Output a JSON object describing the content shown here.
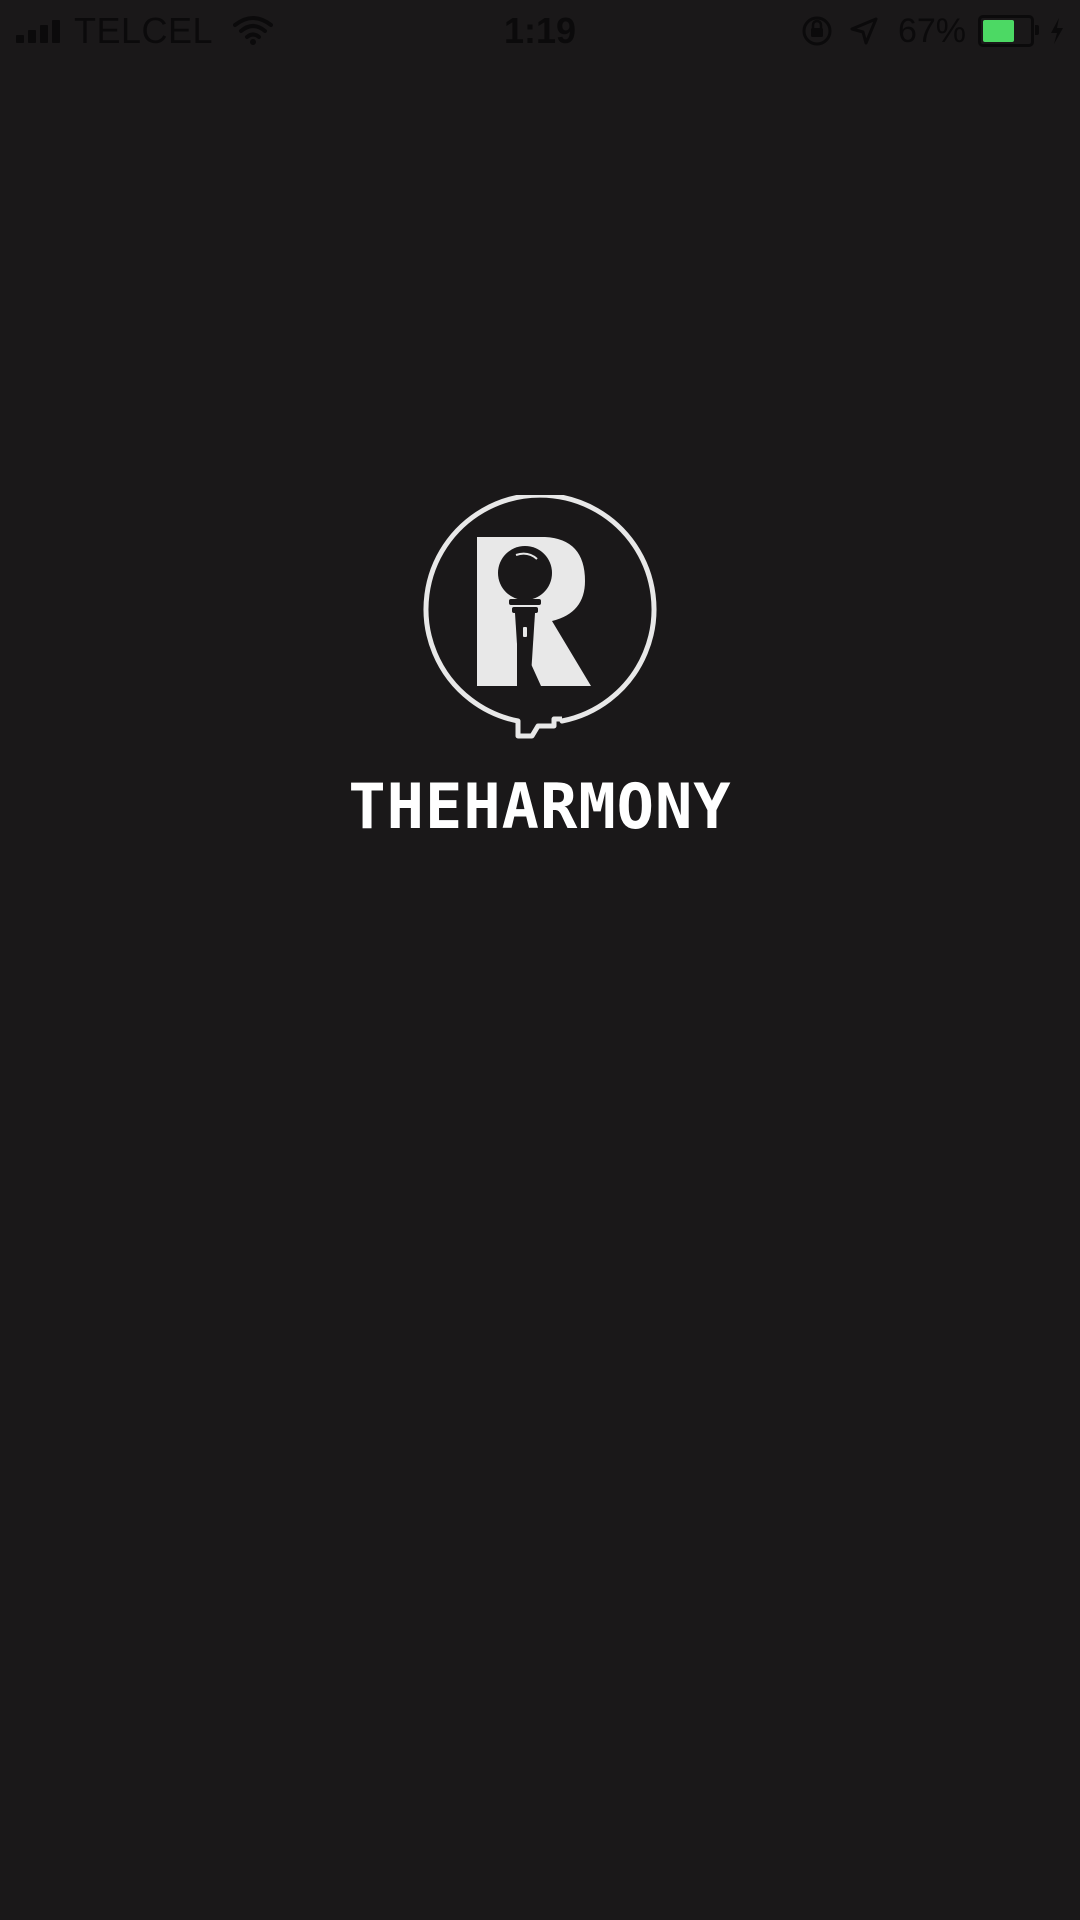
{
  "status_bar": {
    "carrier": "TELCEL",
    "time": "1:19",
    "battery_percent": "67%",
    "battery_level": 0.67,
    "battery_color": "#4cd964",
    "icons": [
      "signal-icon",
      "wifi-icon",
      "orientation-lock-icon",
      "location-arrow-icon",
      "battery-icon",
      "charging-bolt-icon"
    ]
  },
  "splash": {
    "app_name": "THEHARMONY",
    "logo_icon": "microphone-r-logo",
    "background_color": "#1a1819",
    "logo_color": "#e8e8e8"
  }
}
